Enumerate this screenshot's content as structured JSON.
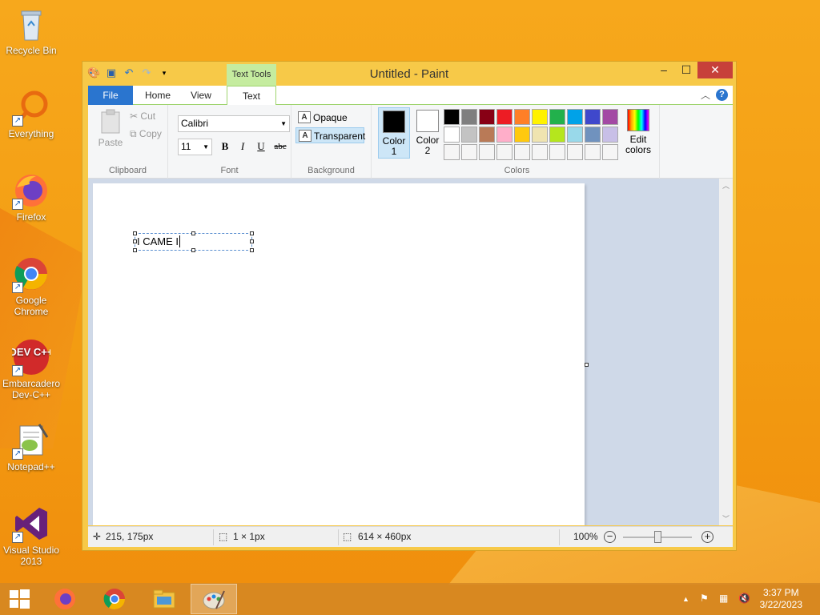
{
  "desktop": {
    "icons": [
      {
        "label": "Recycle Bin"
      },
      {
        "label": "Everything"
      },
      {
        "label": "Firefox"
      },
      {
        "label": "Google Chrome"
      },
      {
        "label": "Embarcadero Dev-C++"
      },
      {
        "label": "Notepad++"
      },
      {
        "label": "Visual Studio 2013"
      }
    ],
    "devcpp_logo": "DEV C++"
  },
  "window": {
    "title": "Untitled - Paint",
    "context_tab": "Text Tools",
    "controls": {
      "minimize": "–",
      "maximize": "☐",
      "close": "✕"
    }
  },
  "tabs": {
    "file": "File",
    "home": "Home",
    "view": "View",
    "text": "Text"
  },
  "ribbon": {
    "clipboard": {
      "label": "Clipboard",
      "paste": "Paste",
      "cut": "Cut",
      "copy": "Copy"
    },
    "font": {
      "label": "Font",
      "family": "Calibri",
      "size": "11",
      "bold": "B",
      "italic": "I",
      "underline": "U",
      "strike": "abc"
    },
    "background": {
      "label": "Background",
      "opaque": "Opaque",
      "transparent": "Transparent"
    },
    "colors": {
      "label": "Colors",
      "color1": "Color 1",
      "color2": "Color 2",
      "edit": "Edit colors",
      "color1_value": "#000000",
      "color2_value": "#ffffff",
      "palette": [
        "#000000",
        "#7f7f7f",
        "#880015",
        "#ed1c24",
        "#ff7f27",
        "#fff200",
        "#22b14c",
        "#00a2e8",
        "#3f48cc",
        "#a349a4",
        "#ffffff",
        "#c3c3c3",
        "#b97a57",
        "#ffaec9",
        "#ffc90e",
        "#efe4b0",
        "#b5e61d",
        "#99d9ea",
        "#7092be",
        "#c8bfe7",
        "#f5f5f5",
        "#f5f5f5",
        "#f5f5f5",
        "#f5f5f5",
        "#f5f5f5",
        "#f5f5f5",
        "#f5f5f5",
        "#f5f5f5",
        "#f5f5f5",
        "#f5f5f5"
      ]
    }
  },
  "canvas": {
    "text_content": "I CAME I"
  },
  "status": {
    "cursor_pos": "215, 175px",
    "selection_size": "1 × 1px",
    "image_size": "614 × 460px",
    "zoom": "100%"
  },
  "taskbar": {
    "time": "3:37 PM",
    "date": "3/22/2023"
  }
}
